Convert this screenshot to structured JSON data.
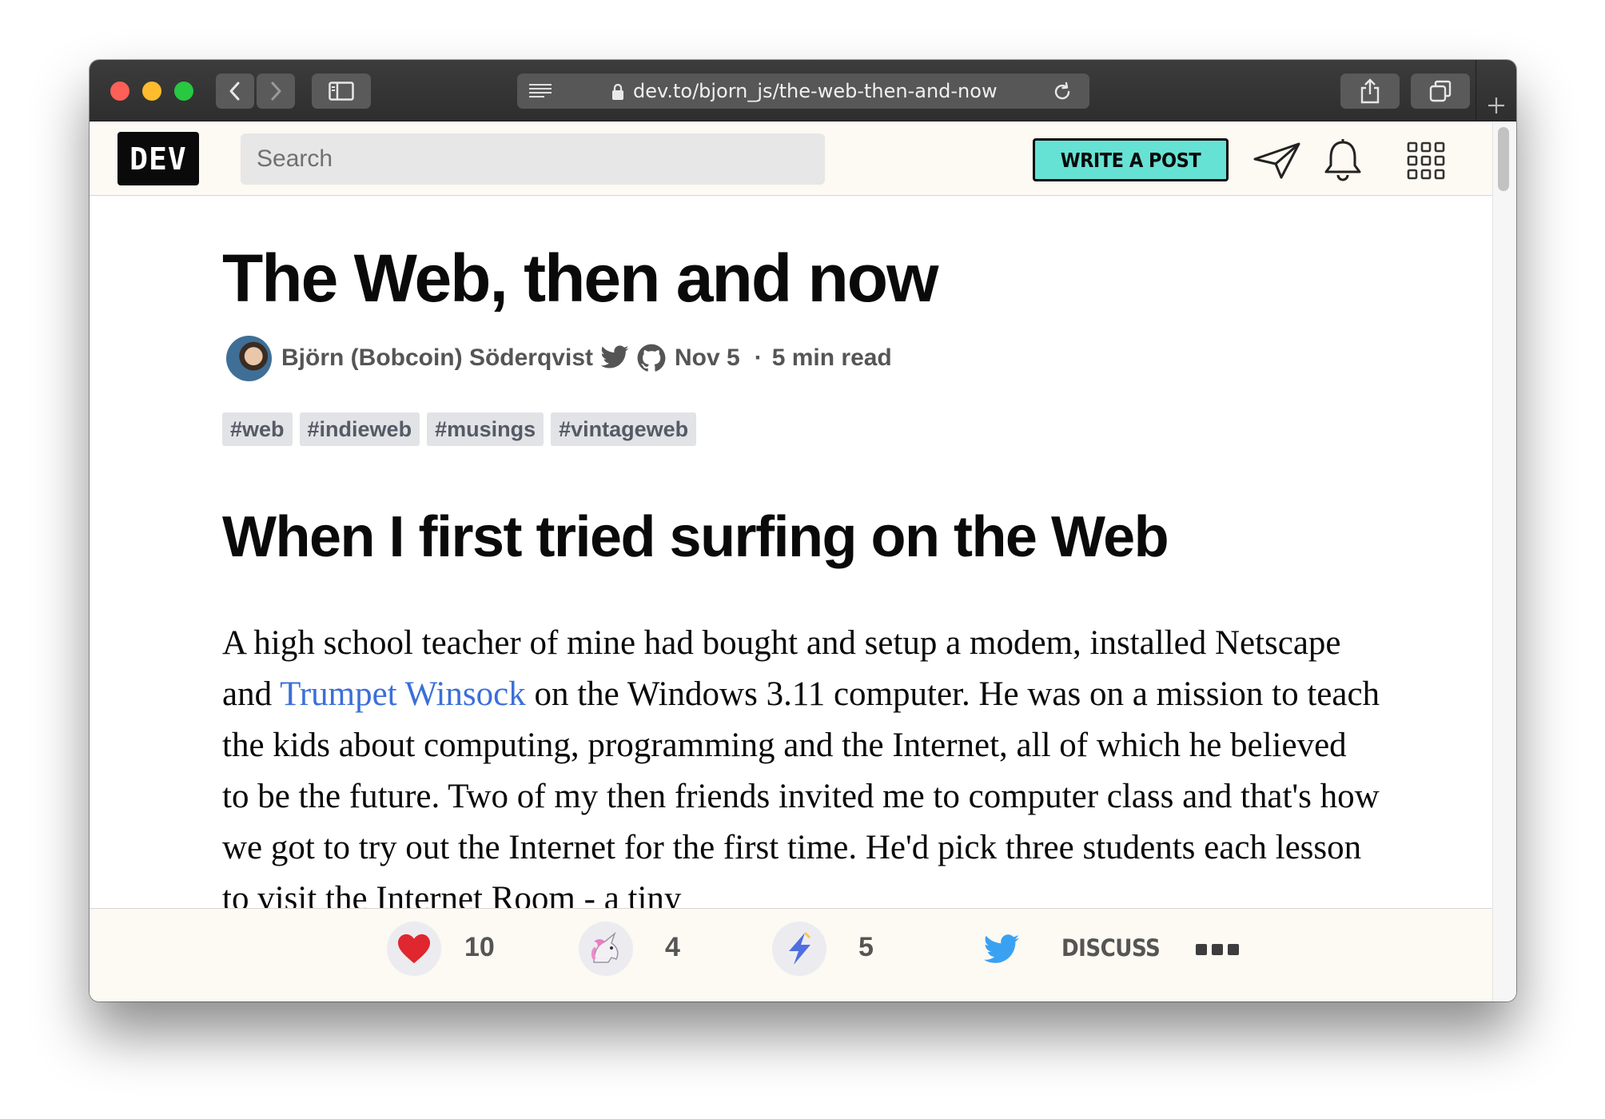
{
  "browser": {
    "url": "dev.to/bjorn_js/the-web-then-and-now"
  },
  "site": {
    "logo": "DEV",
    "search_placeholder": "Search",
    "write_button": "WRITE A POST"
  },
  "article": {
    "title": "The Web, then and now",
    "author": "Björn (Bobcoin) Söderqvist",
    "date": "Nov 5",
    "separator": "·",
    "read_time": "5 min read",
    "tags": [
      "#web",
      "#indieweb",
      "#musings",
      "#vintageweb"
    ],
    "heading": "When I first tried surfing on the Web",
    "body_before_link": "A high school teacher of mine had bought and setup a modem, installed Netscape and ",
    "link_text": "Trumpet Winsock",
    "body_after_link": " on the Windows 3.11 computer. He was on a mission to teach the kids about computing, programming and the Internet, all of which he believed to be the future. Two of my then friends invited me to computer class and that's how we got to try out the Internet for the first time. He'd pick three students each lesson to visit the Internet Room - a tiny"
  },
  "reactions": {
    "hearts": "10",
    "unicorns": "4",
    "saves": "5",
    "discuss_label": "DISCUSS"
  },
  "colors": {
    "accent_teal": "#66e2d5",
    "link_blue": "#3b6fd8",
    "header_bg": "#fdf9f3"
  }
}
